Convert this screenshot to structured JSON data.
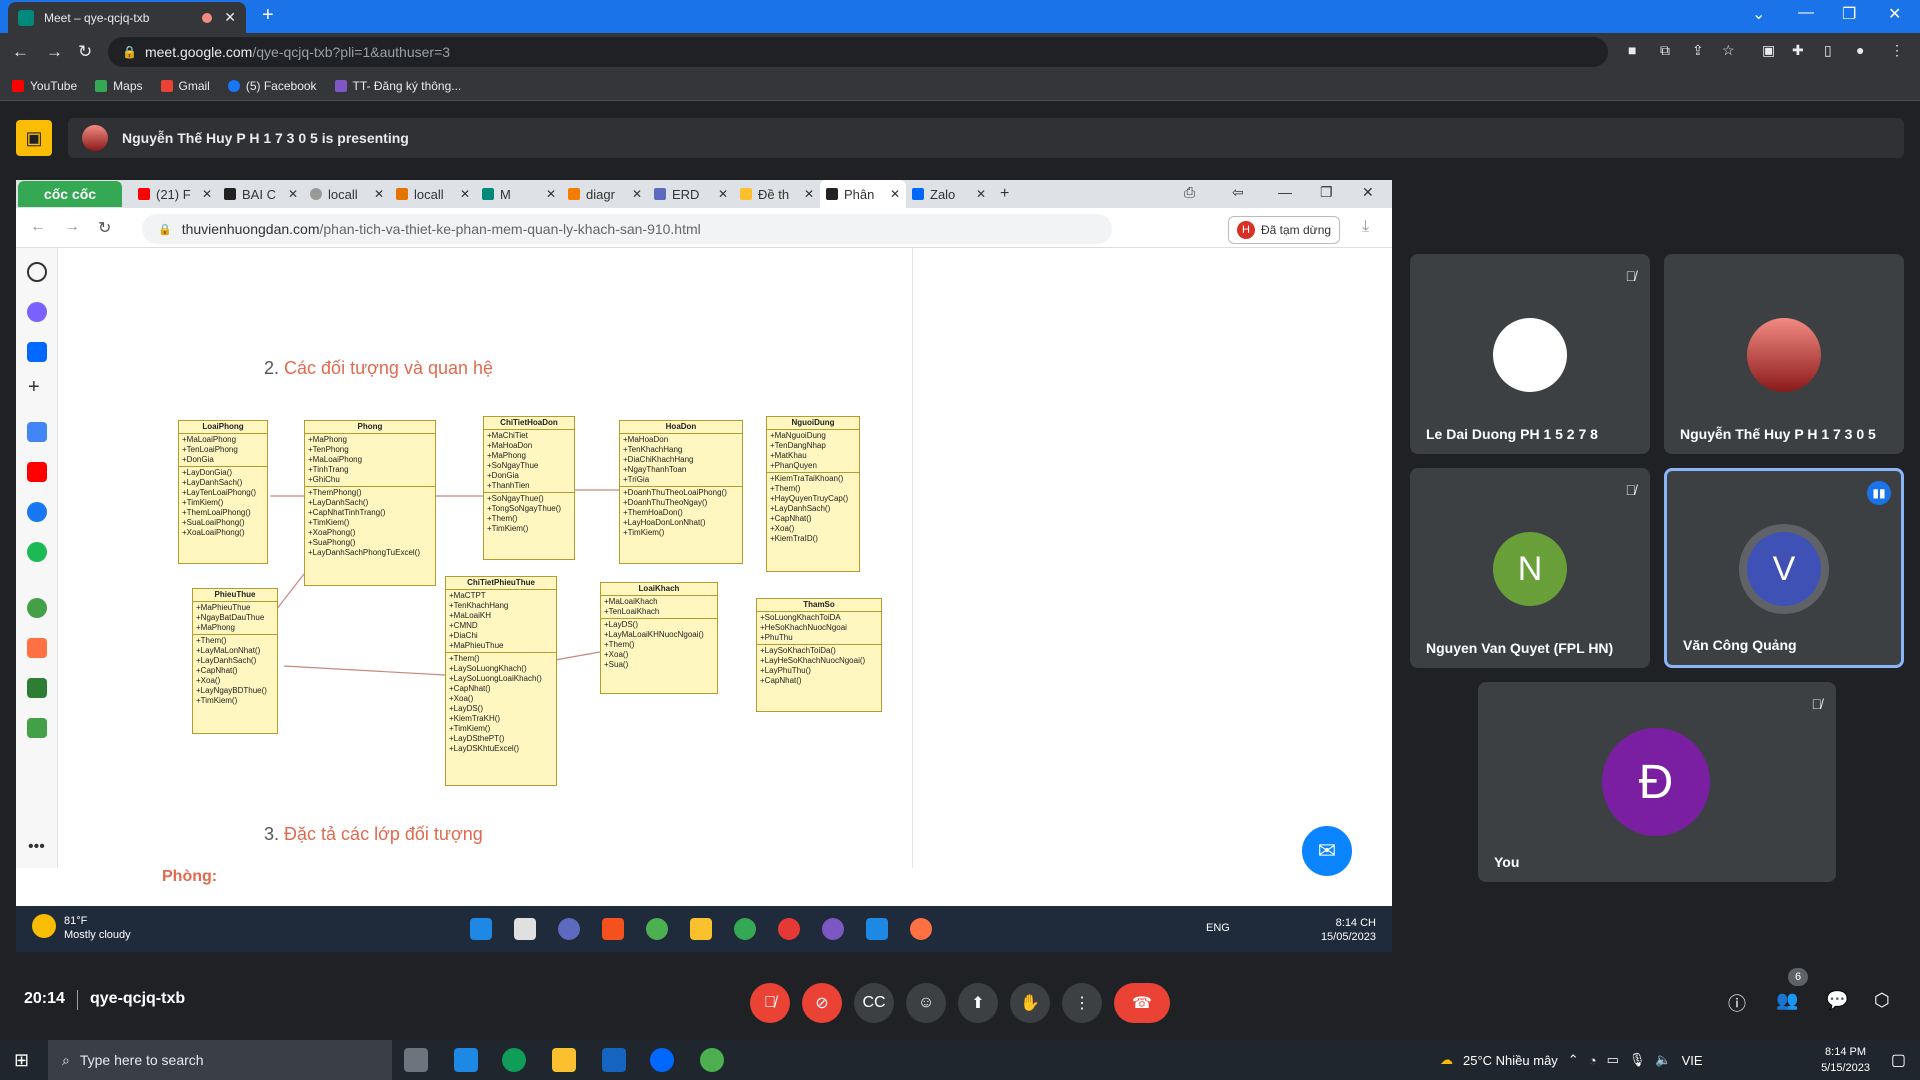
{
  "browser": {
    "tab_title": "Meet – qye-qcjq-txb",
    "new_tab": "+",
    "url_host": "meet.google.com",
    "url_path": "/qye-qcjq-txb?pli=1&authuser=3",
    "bookmarks": [
      "YouTube",
      "Maps",
      "Gmail",
      "(5) Facebook",
      "TT- Đăng ký thông..."
    ]
  },
  "presenting": {
    "label": "Nguyễn Thế Huy P H 1 7 3 0 5 is presenting"
  },
  "shared": {
    "brand": "cốc cốc",
    "tabs": [
      "(21) F",
      "BAI C",
      "locall",
      "locall",
      "M",
      "diagr",
      "ERD",
      "Đề th",
      "Phân",
      "Zalo"
    ],
    "url_host": "thuvienhuongdan.com",
    "url_path": "/phan-tich-va-thiet-ke-phan-mem-quan-ly-khach-san-910.html",
    "paused_label": "Đã tạm dừng",
    "paused_initial": "H",
    "heading2_num": "2.",
    "heading2": "Các đối tượng và quan hệ",
    "heading3_num": "3.",
    "heading3": "Đặc tả các lớp đối tượng",
    "room_label": "Phòng:",
    "weather_temp": "81°F",
    "weather_desc": "Mostly cloudy",
    "tray_lang": "ENG",
    "tray_time": "8:14 CH",
    "tray_date": "15/05/2023",
    "uml": [
      {
        "title": "LoaiPhong",
        "attrs": "+MaLoaiPhong\n+TenLoaiPhong\n+DonGia",
        "ops": "+LayDonGia()\n+LayDanhSach()\n+LayTenLoaiPhong()\n+TimKiem()\n+ThemLoaiPhong()\n+SuaLoaiPhong()\n+XoaLoaiPhong()"
      },
      {
        "title": "Phong",
        "attrs": "+MaPhong\n+TenPhong\n+MaLoaiPhong\n+TinhTrang\n+GhiChu",
        "ops": "+ThemPhong()\n+LayDanhSach()\n+CapNhatTinhTrang()\n+TimKiem()\n+XoaPhong()\n+SuaPhong()\n+LayDanhSachPhongTuExcel()"
      },
      {
        "title": "ChiTietHoaDon",
        "attrs": "+MaChiTiet\n+MaHoaDon\n+MaPhong\n+SoNgayThue\n+DonGia\n+ThanhTien",
        "ops": "+SoNgayThue()\n+TongSoNgayThue()\n+Them()\n+TimKiem()"
      },
      {
        "title": "HoaDon",
        "attrs": "+MaHoaDon\n+TenKhachHang\n+DiaChiKhachHang\n+NgayThanhToan\n+TriGia",
        "ops": "+DoanhThuTheoLoaiPhong()\n+DoanhThuTheoNgay()\n+ThemHoaDon()\n+LayHoaDonLonNhat()\n+TimKiem()"
      },
      {
        "title": "NguoiDung",
        "attrs": "+MaNguoiDung\n+TenDangNhap\n+MatKhau\n+PhanQuyen",
        "ops": "+KiemTraTaiKhoan()\n+Them()\n+HayQuyenTruyCap()\n+LayDanhSach()\n+CapNhat()\n+Xoa()\n+KiemTraID()"
      },
      {
        "title": "PhieuThue",
        "attrs": "+MaPhieuThue\n+NgayBatDauThue\n+MaPhong",
        "ops": "+Them()\n+LayMaLonNhat()\n+LayDanhSach()\n+CapNhat()\n+Xoa()\n+LayNgayBDThue()\n+TimKiem()"
      },
      {
        "title": "ChiTietPhieuThue",
        "attrs": "+MaCTPT\n+TenKhachHang\n+MaLoaiKH\n+CMND\n+DiaChi\n+MaPhieuThue",
        "ops": "+Them()\n+LaySoLuongKhach()\n+LaySoLuongLoaiKhach()\n+CapNhat()\n+Xoa()\n+LayDS()\n+KiemTraKH()\n+TimKiem()\n+LayDSthePT()\n+LayDSKhtuExcel()"
      },
      {
        "title": "LoaiKhach",
        "attrs": "+MaLoaiKhach\n+TenLoaiKhach",
        "ops": "+LayDS()\n+LayMaLoaiKHNuocNgoai()\n+Them()\n+Xoa()\n+Sua()"
      },
      {
        "title": "ThamSo",
        "attrs": "+SoLuongKhachToiDA\n+HeSoKhachNuocNgoai\n+PhuThu",
        "ops": "+LaySoKhachToiDa()\n+LayHeSoKhachNuocNgoai()\n+LayPhuThu()\n+CapNhat()"
      }
    ]
  },
  "participants": [
    {
      "name": "Le Dai Duong PH 1 5 2 7 8",
      "initial": "",
      "color": "#ffffff",
      "muted": true
    },
    {
      "name": "Nguyễn Thế Huy P H 1 7 3 0 5",
      "initial": "",
      "color": "#c0392b",
      "muted": false
    },
    {
      "name": "Nguyen Van Quyet (FPL HN)",
      "initial": "N",
      "color": "#689f38",
      "muted": true
    },
    {
      "name": "Văn Công Quảng",
      "initial": "V",
      "color": "#3f51b5",
      "muted": false
    },
    {
      "name": "You",
      "initial": "Đ",
      "color": "#7b1fa2",
      "muted": true
    }
  ],
  "meeting": {
    "time": "20:14",
    "code": "qye-qcjq-txb",
    "people_count": "6"
  },
  "windows": {
    "search_placeholder": "Type here to search",
    "weather": "25°C  Nhiều mây",
    "lang": "VIE",
    "time": "8:14 PM",
    "date": "5/15/2023"
  },
  "colors": {
    "accent": "#1a73e8",
    "end_call": "#ea4335",
    "present_stop": "#fbbc04"
  }
}
